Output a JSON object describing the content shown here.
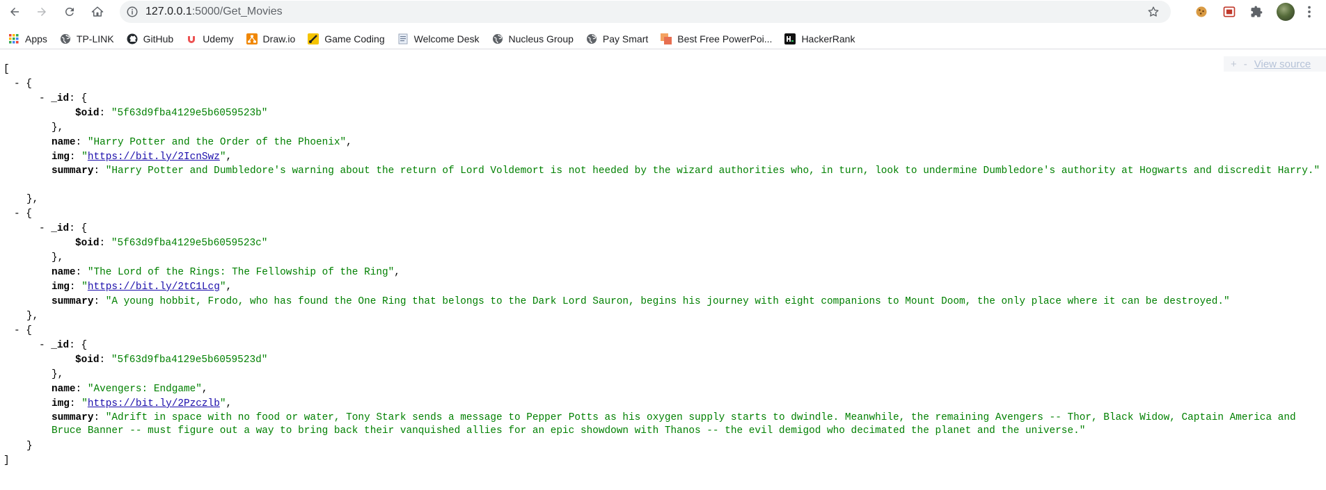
{
  "browser": {
    "url_host": "127.0.0.1",
    "url_path": ":5000/Get_Movies",
    "bookmarks": [
      {
        "label": "Apps",
        "icon": "apps-grid-icon"
      },
      {
        "label": "TP-LINK",
        "icon": "globe-icon"
      },
      {
        "label": "GitHub",
        "icon": "github-icon"
      },
      {
        "label": "Udemy",
        "icon": "udemy-icon"
      },
      {
        "label": "Draw.io",
        "icon": "drawio-icon"
      },
      {
        "label": "Game Coding",
        "icon": "game-coding-icon"
      },
      {
        "label": "Welcome Desk",
        "icon": "document-icon"
      },
      {
        "label": "Nucleus Group",
        "icon": "globe-icon"
      },
      {
        "label": "Pay Smart",
        "icon": "globe-icon"
      },
      {
        "label": "Best Free PowerPoi...",
        "icon": "powerpoint-icon"
      },
      {
        "label": "HackerRank",
        "icon": "hackerrank-icon"
      }
    ]
  },
  "viewer": {
    "plus": "+",
    "minus": "-",
    "view_source": "View source"
  },
  "json_tokens": {
    "open_bracket": "[",
    "close_bracket": "]",
    "collapse": "-",
    "open_brace": "{",
    "close_brace": "}",
    "close_brace_comma": "},",
    "comma": ",",
    "colon": ": ",
    "quote": "\""
  },
  "keys": {
    "id": "_id",
    "oid": "$oid",
    "name": "name",
    "img": "img",
    "summary": "summary"
  },
  "movies": [
    {
      "oid": "\"5f63d9fba4129e5b6059523b\"",
      "name": "\"Harry Potter and the Order of the Phoenix\"",
      "img": "https://bit.ly/2IcnSwz",
      "summary": "\"Harry Potter and Dumbledore's warning about the return of Lord Voldemort is not heeded by the wizard authorities who, in turn, look to undermine Dumbledore's authority at Hogwarts and discredit Harry.\""
    },
    {
      "oid": "\"5f63d9fba4129e5b6059523c\"",
      "name": "\"The Lord of the Rings: The Fellowship of the Ring\"",
      "img": "https://bit.ly/2tC1Lcg",
      "summary": "\"A young hobbit, Frodo, who has found the One Ring that belongs to the Dark Lord Sauron, begins his journey with eight companions to Mount Doom, the only place where it can be destroyed.\""
    },
    {
      "oid": "\"5f63d9fba4129e5b6059523d\"",
      "name": "\"Avengers: Endgame\"",
      "img": "https://bit.ly/2Pzczlb",
      "summary": "\"Adrift in space with no food or water, Tony Stark sends a message to Pepper Potts as his oxygen supply starts to dwindle. Meanwhile, the remaining Avengers -- Thor, Black Widow, Captain America and Bruce Banner -- must figure out a way to bring back their vanquished allies for an epic showdown with Thanos -- the evil demigod who decimated the planet and the universe.\""
    }
  ]
}
